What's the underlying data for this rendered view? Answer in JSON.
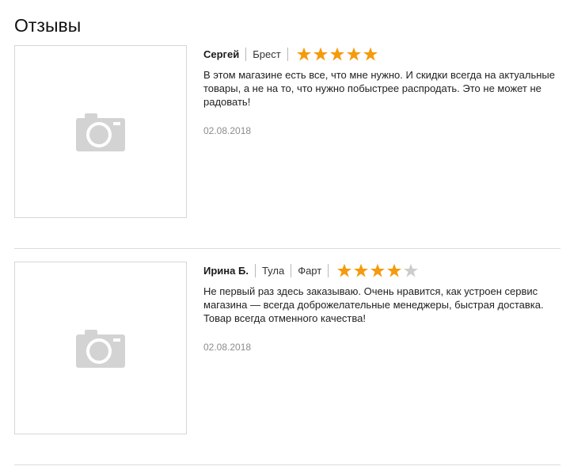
{
  "page": {
    "title": "Отзывы"
  },
  "reviews": [
    {
      "author": "Сергей",
      "city": "Брест",
      "extra": "",
      "rating": 5,
      "text": "В этом магазине есть все, что мне нужно. И скидки всегда на актуальные товары, а не на то, что нужно побыстрее распродать. Это не может не радовать!",
      "date": "02.08.2018",
      "photo_icon": "camera-icon"
    },
    {
      "author": "Ирина Б.",
      "city": "Тула",
      "extra": "Фарт",
      "rating": 4,
      "text": "Не первый раз здесь заказываю. Очень нравится, как устроен сервис магазина — всегда доброжелательные менеджеры, быстрая доставка. Товар всегда отменного качества!",
      "date": "02.08.2018",
      "photo_icon": "camera-icon"
    }
  ],
  "colors": {
    "star_filled": "#f59a0b",
    "star_empty": "#cccccc",
    "placeholder_icon": "#d3d3d3"
  }
}
